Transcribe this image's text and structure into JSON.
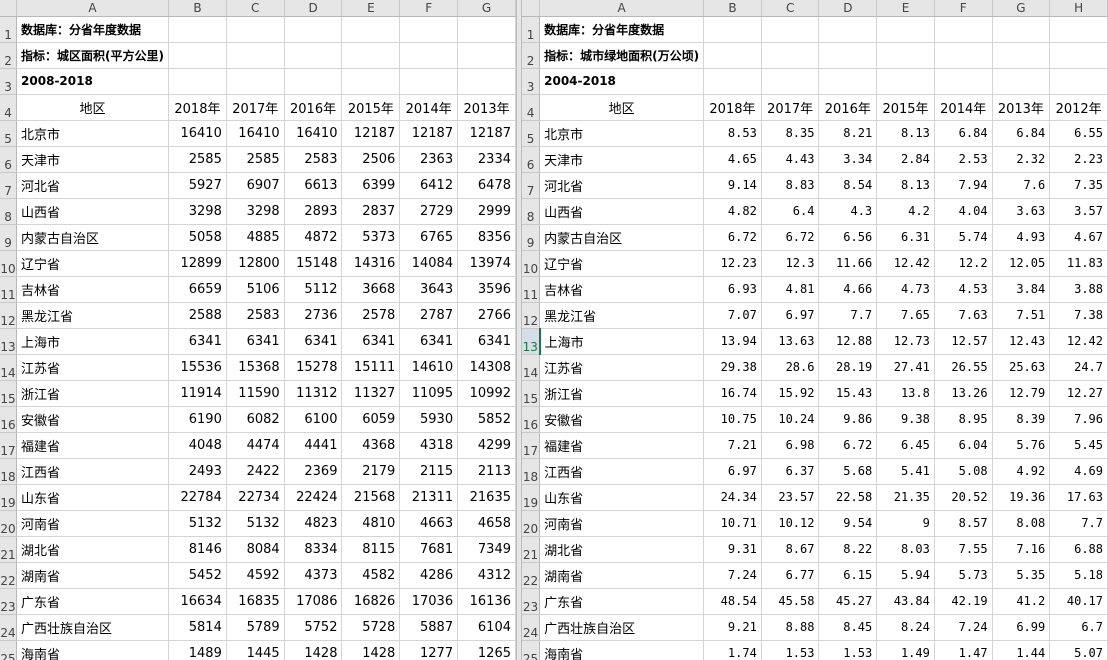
{
  "left": {
    "columns": [
      "A",
      "B",
      "C",
      "D",
      "E",
      "F",
      "G"
    ],
    "row_numbers": [
      "1",
      "2",
      "3",
      "4",
      "5",
      "6",
      "7",
      "8",
      "9",
      "10",
      "11",
      "12",
      "13",
      "14",
      "15",
      "16",
      "17",
      "18",
      "19",
      "20",
      "21",
      "22",
      "23",
      "24",
      "25"
    ],
    "active_row": "",
    "title_rows": [
      "数据库：分省年度数据",
      "指标：城区面积(平方公里)",
      "2008-2018"
    ],
    "header": [
      "地区",
      "2018年",
      "2017年",
      "2016年",
      "2015年",
      "2014年",
      "2013年"
    ],
    "rows": [
      [
        "北京市",
        "16410",
        "16410",
        "16410",
        "12187",
        "12187",
        "12187"
      ],
      [
        "天津市",
        "2585",
        "2585",
        "2583",
        "2506",
        "2363",
        "2334"
      ],
      [
        "河北省",
        "5927",
        "6907",
        "6613",
        "6399",
        "6412",
        "6478"
      ],
      [
        "山西省",
        "3298",
        "3298",
        "2893",
        "2837",
        "2729",
        "2999"
      ],
      [
        "内蒙古自治区",
        "5058",
        "4885",
        "4872",
        "5373",
        "6765",
        "8356"
      ],
      [
        "辽宁省",
        "12899",
        "12800",
        "15148",
        "14316",
        "14084",
        "13974"
      ],
      [
        "吉林省",
        "6659",
        "5106",
        "5112",
        "3668",
        "3643",
        "3596"
      ],
      [
        "黑龙江省",
        "2588",
        "2583",
        "2736",
        "2578",
        "2787",
        "2766"
      ],
      [
        "上海市",
        "6341",
        "6341",
        "6341",
        "6341",
        "6341",
        "6341"
      ],
      [
        "江苏省",
        "15536",
        "15368",
        "15278",
        "15111",
        "14610",
        "14308"
      ],
      [
        "浙江省",
        "11914",
        "11590",
        "11312",
        "11327",
        "11095",
        "10992"
      ],
      [
        "安徽省",
        "6190",
        "6082",
        "6100",
        "6059",
        "5930",
        "5852"
      ],
      [
        "福建省",
        "4048",
        "4474",
        "4441",
        "4368",
        "4318",
        "4299"
      ],
      [
        "江西省",
        "2493",
        "2422",
        "2369",
        "2179",
        "2115",
        "2113"
      ],
      [
        "山东省",
        "22784",
        "22734",
        "22424",
        "21568",
        "21311",
        "21635"
      ],
      [
        "河南省",
        "5132",
        "5132",
        "4823",
        "4810",
        "4663",
        "4658"
      ],
      [
        "湖北省",
        "8146",
        "8084",
        "8334",
        "8115",
        "7681",
        "7349"
      ],
      [
        "湖南省",
        "5452",
        "4592",
        "4373",
        "4582",
        "4286",
        "4312"
      ],
      [
        "广东省",
        "16634",
        "16835",
        "17086",
        "16826",
        "17036",
        "16136"
      ],
      [
        "广西壮族自治区",
        "5814",
        "5789",
        "5752",
        "5728",
        "5887",
        "6104"
      ],
      [
        "海南省",
        "1489",
        "1445",
        "1428",
        "1428",
        "1277",
        "1265"
      ]
    ]
  },
  "right": {
    "columns": [
      "A",
      "B",
      "C",
      "D",
      "E",
      "F",
      "G",
      "H"
    ],
    "row_numbers": [
      "1",
      "2",
      "3",
      "4",
      "5",
      "6",
      "7",
      "8",
      "9",
      "10",
      "11",
      "12",
      "13",
      "14",
      "15",
      "16",
      "17",
      "18",
      "19",
      "20",
      "21",
      "22",
      "23",
      "24",
      "25"
    ],
    "active_row": "13",
    "title_rows": [
      "数据库：分省年度数据",
      "指标：城市绿地面积(万公顷)",
      "2004-2018"
    ],
    "header": [
      "地区",
      "2018年",
      "2017年",
      "2016年",
      "2015年",
      "2014年",
      "2013年",
      "2012年"
    ],
    "rows": [
      [
        "北京市",
        "8.53",
        "8.35",
        "8.21",
        "8.13",
        "6.84",
        "6.84",
        "6.55"
      ],
      [
        "天津市",
        "4.65",
        "4.43",
        "3.34",
        "2.84",
        "2.53",
        "2.32",
        "2.23"
      ],
      [
        "河北省",
        "9.14",
        "8.83",
        "8.54",
        "8.13",
        "7.94",
        "7.6",
        "7.35"
      ],
      [
        "山西省",
        "4.82",
        "6.4",
        "4.3",
        "4.2",
        "4.04",
        "3.63",
        "3.57"
      ],
      [
        "内蒙古自治区",
        "6.72",
        "6.72",
        "6.56",
        "6.31",
        "5.74",
        "4.93",
        "4.67"
      ],
      [
        "辽宁省",
        "12.23",
        "12.3",
        "11.66",
        "12.42",
        "12.2",
        "12.05",
        "11.83"
      ],
      [
        "吉林省",
        "6.93",
        "4.81",
        "4.66",
        "4.73",
        "4.53",
        "3.84",
        "3.88"
      ],
      [
        "黑龙江省",
        "7.07",
        "6.97",
        "7.7",
        "7.65",
        "7.63",
        "7.51",
        "7.38"
      ],
      [
        "上海市",
        "13.94",
        "13.63",
        "12.88",
        "12.73",
        "12.57",
        "12.43",
        "12.42"
      ],
      [
        "江苏省",
        "29.38",
        "28.6",
        "28.19",
        "27.41",
        "26.55",
        "25.63",
        "24.7"
      ],
      [
        "浙江省",
        "16.74",
        "15.92",
        "15.43",
        "13.8",
        "13.26",
        "12.79",
        "12.27"
      ],
      [
        "安徽省",
        "10.75",
        "10.24",
        "9.86",
        "9.38",
        "8.95",
        "8.39",
        "7.96"
      ],
      [
        "福建省",
        "7.21",
        "6.98",
        "6.72",
        "6.45",
        "6.04",
        "5.76",
        "5.45"
      ],
      [
        "江西省",
        "6.97",
        "6.37",
        "5.68",
        "5.41",
        "5.08",
        "4.92",
        "4.69"
      ],
      [
        "山东省",
        "24.34",
        "23.57",
        "22.58",
        "21.35",
        "20.52",
        "19.36",
        "17.63"
      ],
      [
        "河南省",
        "10.71",
        "10.12",
        "9.54",
        "9",
        "8.57",
        "8.08",
        "7.7"
      ],
      [
        "湖北省",
        "9.31",
        "8.67",
        "8.22",
        "8.03",
        "7.55",
        "7.16",
        "6.88"
      ],
      [
        "湖南省",
        "7.24",
        "6.77",
        "6.15",
        "5.94",
        "5.73",
        "5.35",
        "5.18"
      ],
      [
        "广东省",
        "48.54",
        "45.58",
        "45.27",
        "43.84",
        "42.19",
        "41.2",
        "40.17"
      ],
      [
        "广西壮族自治区",
        "9.21",
        "8.88",
        "8.45",
        "8.24",
        "7.24",
        "6.99",
        "6.7"
      ],
      [
        "海南省",
        "1.74",
        "1.53",
        "1.53",
        "1.49",
        "1.47",
        "1.44",
        "5.07"
      ]
    ]
  },
  "colors": {
    "header_bg": "#e6e6e6",
    "gridline": "#d4d4d4",
    "active_accent": "#217346"
  }
}
